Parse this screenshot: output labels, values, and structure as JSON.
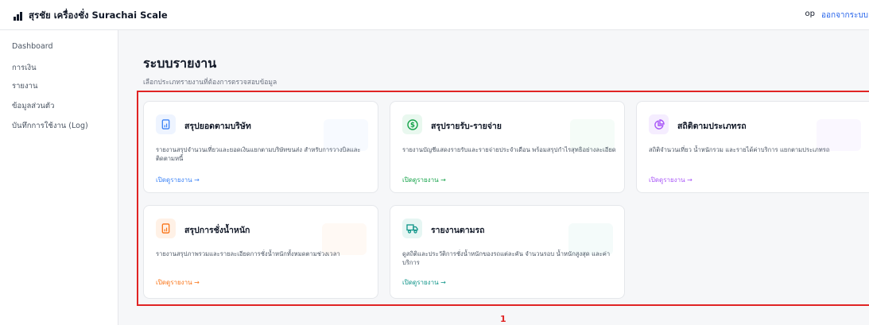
{
  "header": {
    "title": "สุรชัย เครื่องชั่ง Surachai Scale",
    "user": "op",
    "logout_label": "ออกจากระบบ"
  },
  "sidebar": {
    "items": [
      {
        "label": "Dashboard"
      },
      {
        "label": "การเงิน"
      },
      {
        "label": "รายงาน"
      },
      {
        "label": "ข้อมูลส่วนตัว"
      },
      {
        "label": "บันทึกการใช้งาน (Log)"
      }
    ]
  },
  "main": {
    "title": "ระบบรายงาน",
    "subtitle": "เลือกประเภทรายงานที่ต้องการตรวจสอบข้อมูล",
    "cards": [
      {
        "title": "สรุปยอดตามบริษัท",
        "description": "รายงานสรุปจำนวนเที่ยวและยอดเงินแยกตามบริษัทขนส่ง สำหรับการวางบิลและติดตามหนี้",
        "link": "เปิดดูรายงาน →",
        "icon": "document-chart-icon",
        "accent": "#3b82f6",
        "tint": "#eef4ff"
      },
      {
        "title": "สรุปรายรับ-รายจ่าย",
        "description": "รายงานบัญชีแสดงรายรับและรายจ่ายประจำเดือน พร้อมสรุปกำไรสุทธิอย่างละเอียด",
        "link": "เปิดดูรายงาน →",
        "icon": "dollar-circle-icon",
        "accent": "#16a34a",
        "tint": "#e9f8ef"
      },
      {
        "title": "สถิติตามประเภทรถ",
        "description": "สถิติจำนวนเที่ยว น้ำหนักรวม และรายได้ค่าบริการ แยกตามประเภทรถ",
        "link": "เปิดดูรายงาน →",
        "icon": "pie-chart-icon",
        "accent": "#a855f7",
        "tint": "#f5edff"
      },
      {
        "title": "สรุปการชั่งน้ำหนัก",
        "description": "รายงานสรุปภาพรวมและรายละเอียดการชั่งน้ำหนักทั้งหมดตามช่วงเวลา",
        "link": "เปิดดูรายงาน →",
        "icon": "document-chart-icon",
        "accent": "#f97316",
        "tint": "#fff1e6"
      },
      {
        "title": "รายงานตามรถ",
        "description": "ดูสถิติและประวัติการชั่งน้ำหนักของรถแต่ละคัน จำนวนรอบ น้ำหนักสูงสุด และค่าบริการ",
        "link": "เปิดดูรายงาน →",
        "icon": "truck-icon",
        "accent": "#0d9488",
        "tint": "#e6f6f3"
      }
    ]
  },
  "annotation": {
    "number": "1",
    "color": "#e02424"
  }
}
